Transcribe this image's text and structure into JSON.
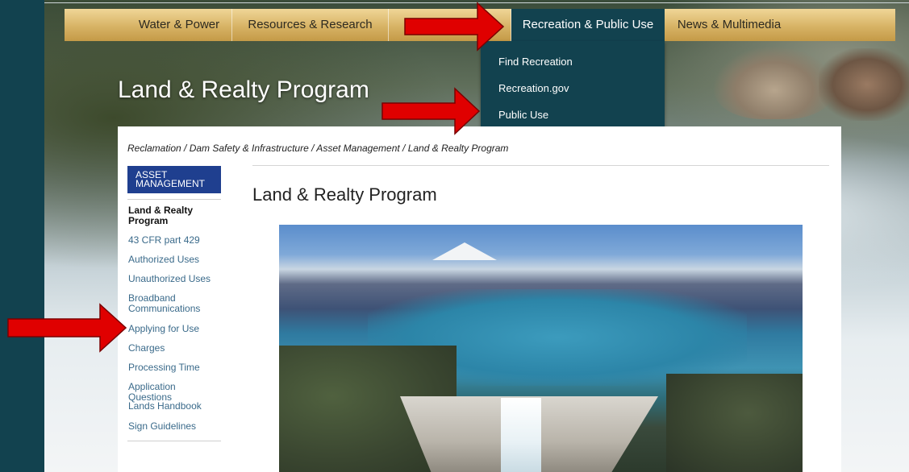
{
  "nav": {
    "items": [
      {
        "label": "Water & Power"
      },
      {
        "label": "Resources & Research"
      },
      {
        "label": ""
      },
      {
        "label": "Recreation & Public Use"
      },
      {
        "label": "News & Multimedia"
      }
    ]
  },
  "dropdown": {
    "items": [
      {
        "label": "Find Recreation"
      },
      {
        "label": "Recreation.gov"
      },
      {
        "label": "Public Use"
      }
    ]
  },
  "hero": {
    "title": "Land & Realty Program"
  },
  "breadcrumb": "Reclamation / Dam Safety & Infrastructure / Asset Management / Land & Realty Program",
  "sidebar": {
    "heading": "ASSET MANAGEMENT",
    "items": [
      {
        "label": "Land & Realty Program",
        "current": true
      },
      {
        "label": "43 CFR part 429"
      },
      {
        "label": "Authorized Uses"
      },
      {
        "label": "Unauthorized Uses"
      },
      {
        "label": "Broadband Communications"
      },
      {
        "label": "Applying for Use"
      },
      {
        "label": "Charges"
      },
      {
        "label": "Processing Time"
      },
      {
        "label": "Application Questions"
      },
      {
        "label": "Lands Handbook"
      },
      {
        "label": "Sign Guidelines"
      }
    ]
  },
  "main": {
    "title": "Land & Realty Program"
  },
  "colors": {
    "accent": "#12424f",
    "nav_gold": "#d7b365",
    "sidebar_heading": "#1f3f8f",
    "annotation_arrow": "#e00000"
  }
}
